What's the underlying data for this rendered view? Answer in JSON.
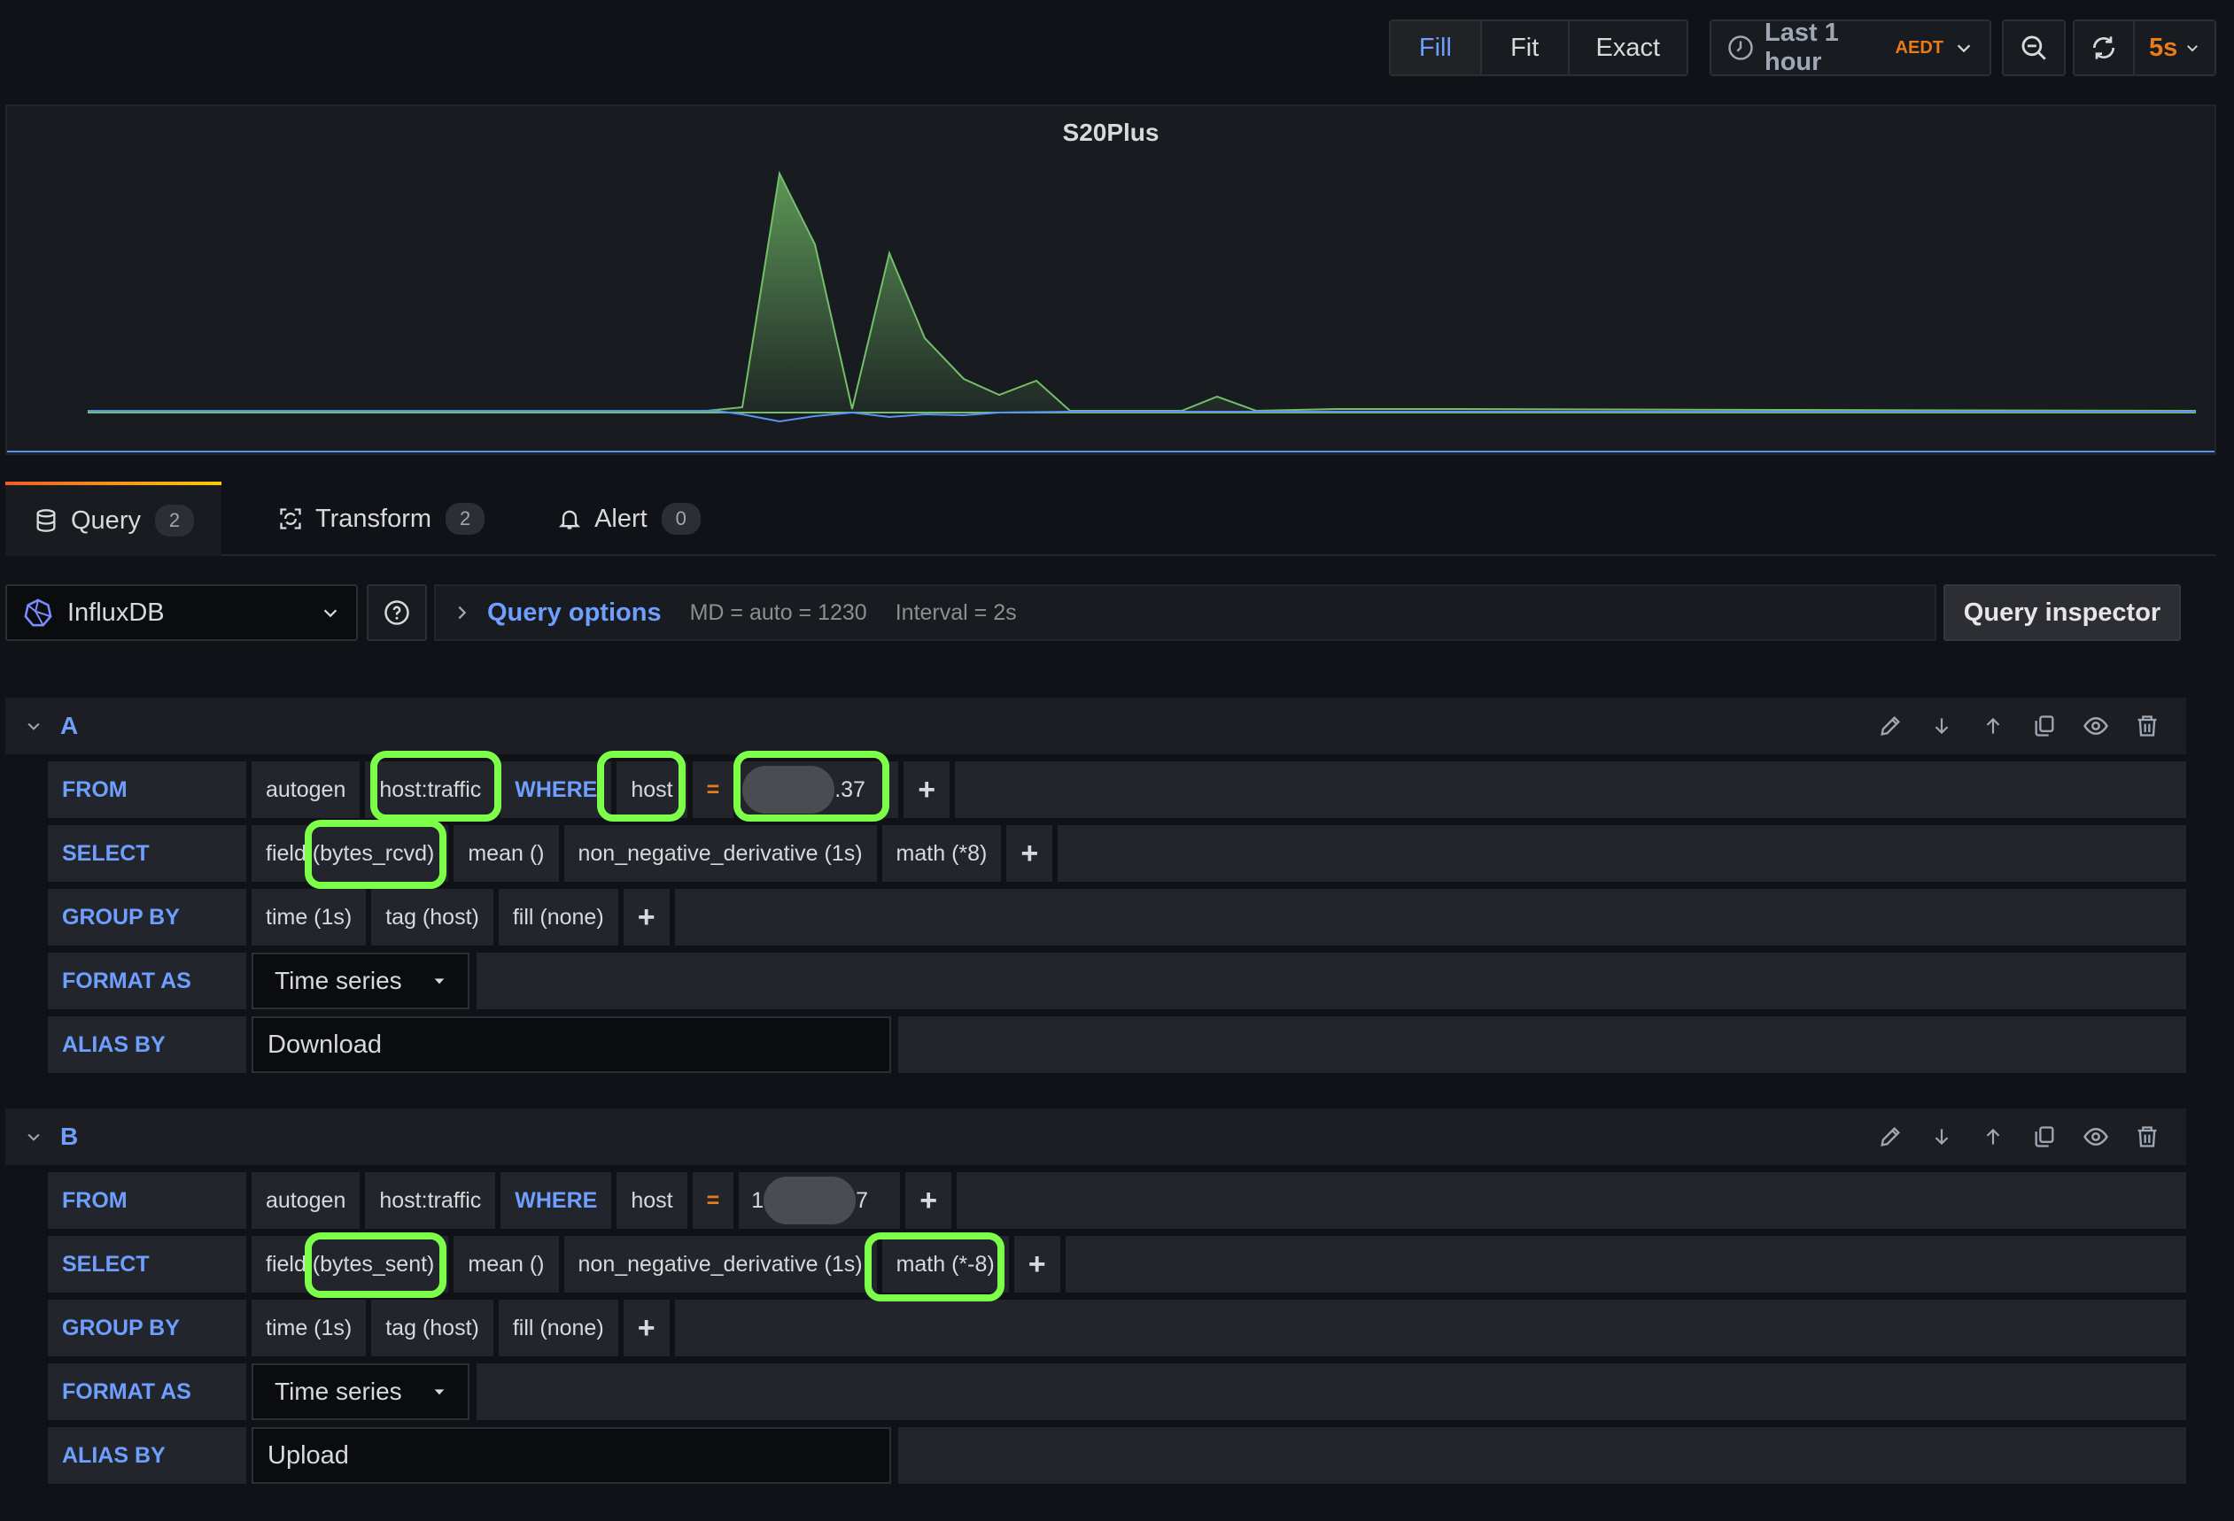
{
  "toolbar": {
    "zoom_modes": [
      "Fill",
      "Fit",
      "Exact"
    ],
    "active_zoom": "Fill",
    "time_range": "Last 1 hour",
    "timezone": "AEDT",
    "refresh_interval": "5s"
  },
  "panel": {
    "title": "S20Plus"
  },
  "tabs": [
    {
      "label": "Query",
      "count": "2",
      "icon": "database-icon"
    },
    {
      "label": "Transform",
      "count": "2",
      "icon": "transform-icon"
    },
    {
      "label": "Alert",
      "count": "0",
      "icon": "bell-icon"
    }
  ],
  "datasource": {
    "name": "InfluxDB"
  },
  "query_options": {
    "title": "Query options",
    "md": "MD = auto = 1230",
    "interval": "Interval = 2s",
    "inspector_label": "Query inspector"
  },
  "queries": [
    {
      "letter": "A",
      "labels": {
        "from": "FROM",
        "select": "SELECT",
        "group_by": "GROUP BY",
        "format_as": "FORMAT AS",
        "alias_by": "ALIAS BY"
      },
      "from": {
        "policy": "autogen",
        "measurement": "host:traffic",
        "where": "WHERE",
        "key": "host",
        "operator": "=",
        "value_visible": ".37"
      },
      "select": [
        "field (bytes_rcvd)",
        "mean ()",
        "non_negative_derivative (1s)",
        "math (*8)"
      ],
      "group_by": [
        "time (1s)",
        "tag (host)",
        "fill (none)"
      ],
      "format_as": "Time series",
      "alias_by": "Download"
    },
    {
      "letter": "B",
      "labels": {
        "from": "FROM",
        "select": "SELECT",
        "group_by": "GROUP BY",
        "format_as": "FORMAT AS",
        "alias_by": "ALIAS BY"
      },
      "from": {
        "policy": "autogen",
        "measurement": "host:traffic",
        "where": "WHERE",
        "key": "host",
        "operator": "=",
        "value_prefix": "1",
        "value_visible": "7"
      },
      "select": [
        "field (bytes_sent)",
        "mean ()",
        "non_negative_derivative (1s)",
        "math (*-8)"
      ],
      "group_by": [
        "time (1s)",
        "tag (host)",
        "fill (none)"
      ],
      "format_as": "Time series",
      "alias_by": "Upload"
    }
  ],
  "colors": {
    "accent_blue": "#6e9fff",
    "operator_orange": "#eb7b18",
    "download_series": "#73bf69",
    "upload_series": "#5794f2",
    "highlight": "#7dff4a"
  }
}
